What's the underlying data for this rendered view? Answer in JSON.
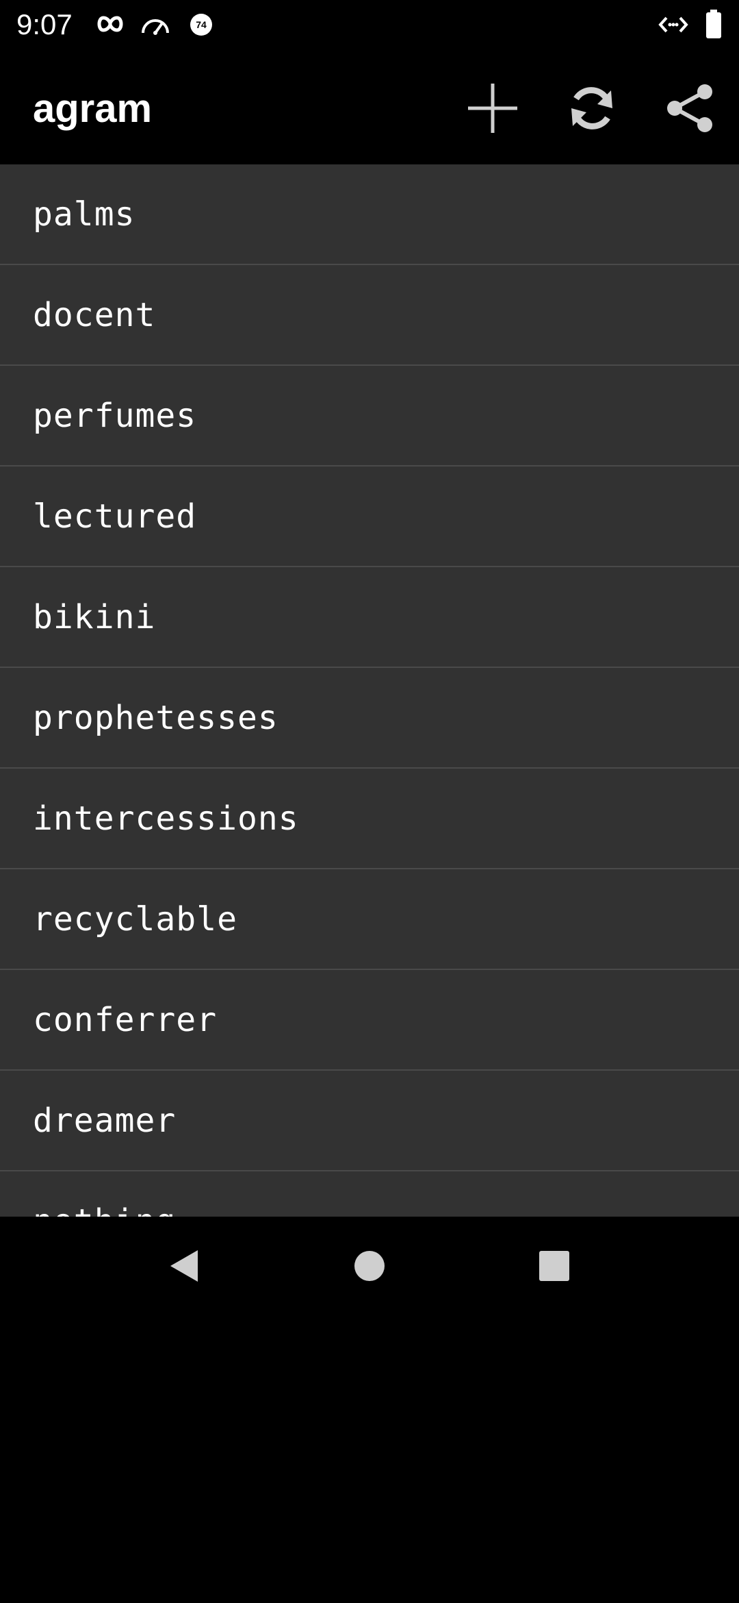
{
  "status_bar": {
    "time": "9:07",
    "notification_icons": [
      "infinity-icon",
      "speedometer-icon",
      "badge-74-icon"
    ],
    "badge_number": "74",
    "right_icons": [
      "code-brackets-icon",
      "battery-icon"
    ]
  },
  "app_bar": {
    "title": "agram",
    "actions": [
      "add-icon",
      "refresh-icon",
      "share-icon"
    ]
  },
  "words": [
    "palms",
    "docent",
    "perfumes",
    "lectured",
    "bikini",
    "prophetesses",
    "intercessions",
    "recyclable",
    "conferrer",
    "dreamer",
    "nothing"
  ],
  "nav_bar": {
    "buttons": [
      "back-icon",
      "home-icon",
      "recents-icon"
    ]
  },
  "colors": {
    "background": "#000000",
    "list_background": "#323232",
    "divider": "#4a4a4a",
    "text": "#ffffff",
    "icon": "#d0d0d0"
  }
}
